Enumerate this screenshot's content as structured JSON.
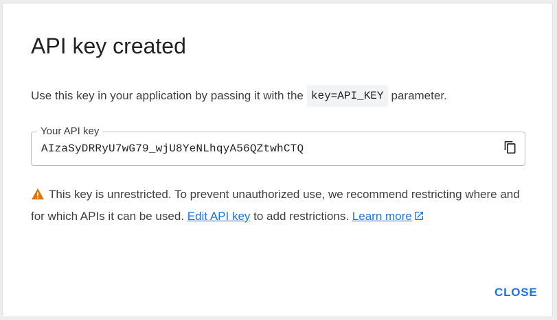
{
  "dialog": {
    "title": "API key created",
    "instruction": {
      "before": "Use this key in your application by passing it with the",
      "code": "key=API_KEY",
      "after": "parameter."
    },
    "key_field": {
      "label": "Your API key",
      "value": "AIzaSyDRRyU7wG79_wjU8YeNLhqyA56QZtwhCTQ",
      "copy_icon": "content-copy-icon"
    },
    "warning": {
      "icon": "warning-icon",
      "text_before": "This key is unrestricted. To prevent unauthorized use, we recommend restricting where and for which APIs it can be used.",
      "edit_link": "Edit API key",
      "text_middle": "to add restrictions.",
      "learn_link": "Learn more",
      "learn_icon": "open-in-new-icon"
    },
    "close_label": "CLOSE"
  },
  "colors": {
    "accent": "#1a73e8",
    "warning": "#e37400",
    "text": "#3c4043"
  }
}
